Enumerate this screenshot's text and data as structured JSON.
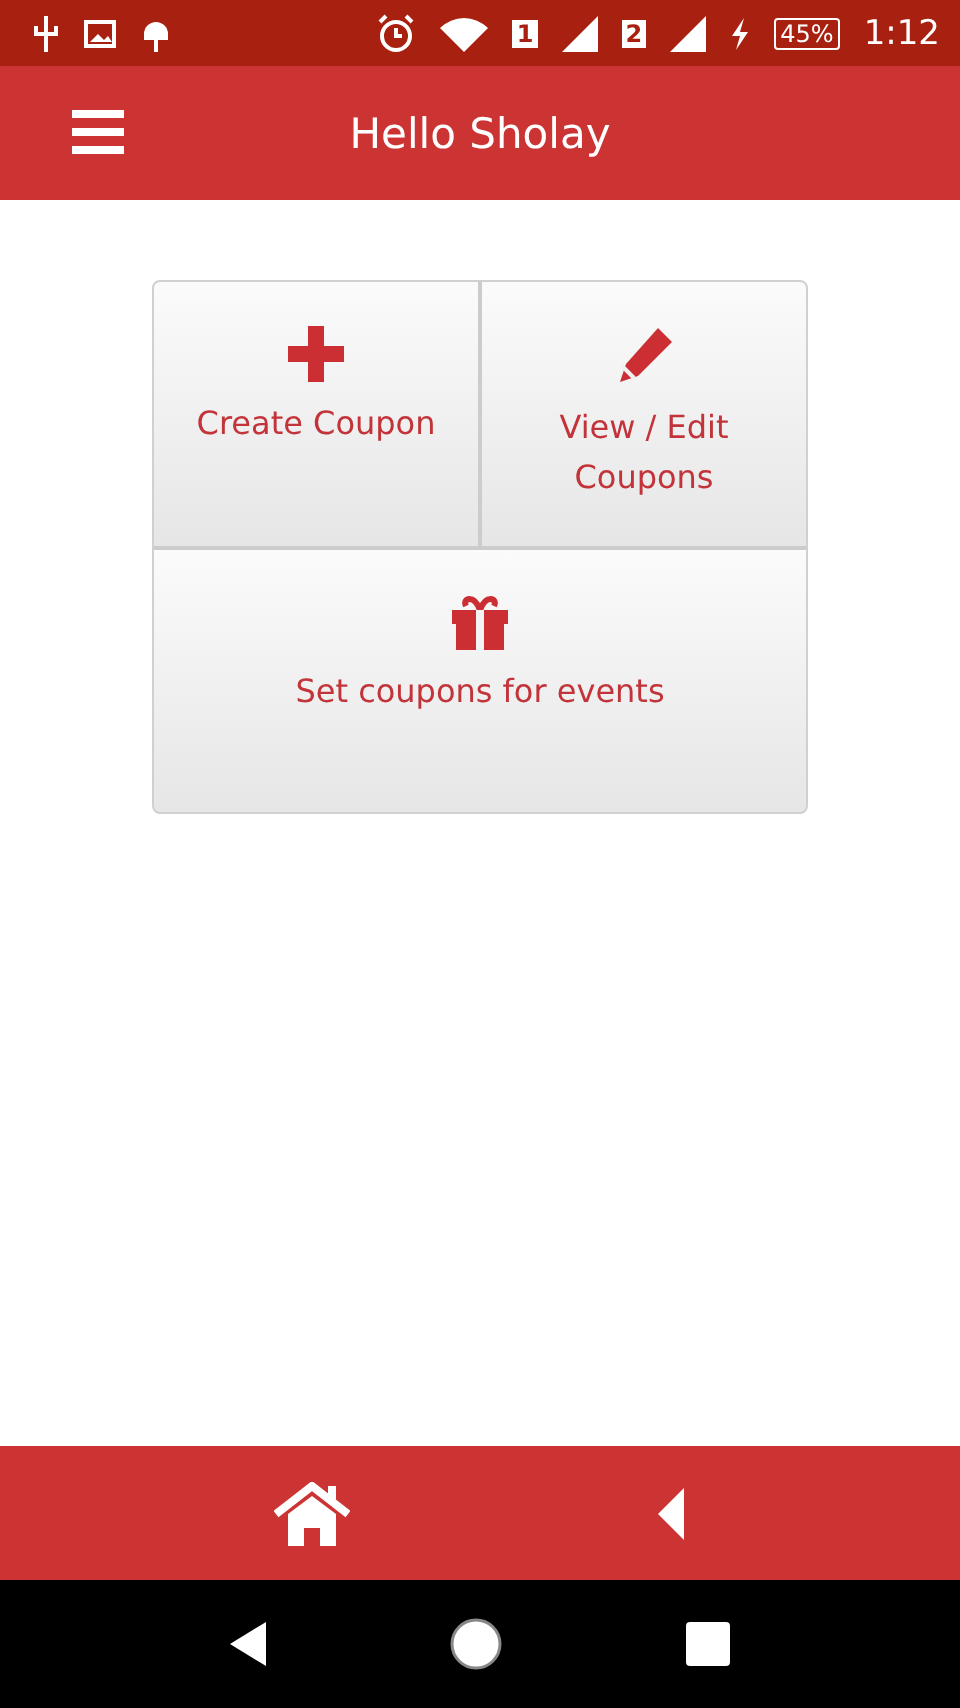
{
  "status_bar": {
    "sim_1": "1",
    "sim_2": "2",
    "battery": "45%",
    "time": "1:12"
  },
  "header": {
    "title": "Hello Sholay"
  },
  "tiles": [
    {
      "kind": "create",
      "label": "Create Coupon",
      "wide": false
    },
    {
      "kind": "edit",
      "label": "View / Edit Coupons",
      "wide": false
    },
    {
      "kind": "events",
      "label": "Set coupons for events",
      "wide": true
    }
  ]
}
